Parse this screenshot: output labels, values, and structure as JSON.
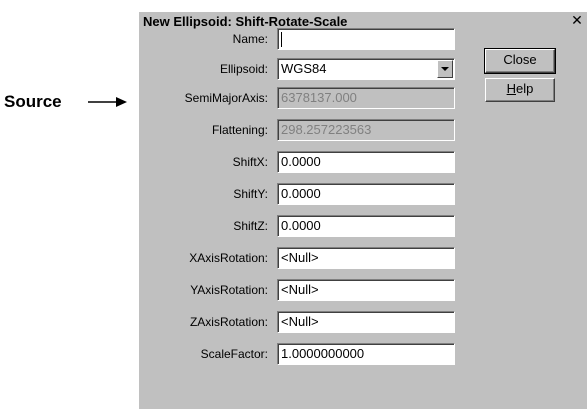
{
  "annotation": {
    "text": "Source"
  },
  "dialog": {
    "title": "New Ellipsoid: Shift-Rotate-Scale",
    "close_glyph": "✕",
    "fields": {
      "name": {
        "label": "Name:",
        "value": ""
      },
      "ellipsoid": {
        "label": "Ellipsoid:",
        "value": "WGS84"
      },
      "semimajor": {
        "label": "SemiMajorAxis:",
        "value": "6378137.000"
      },
      "flattening": {
        "label": "Flattening:",
        "value": "298.257223563"
      },
      "shiftx": {
        "label": "ShiftX:",
        "value": "0.0000"
      },
      "shifty": {
        "label": "ShiftY:",
        "value": "0.0000"
      },
      "shiftz": {
        "label": "ShiftZ:",
        "value": "0.0000"
      },
      "xrot": {
        "label": "XAxisRotation:",
        "value": "<Null>"
      },
      "yrot": {
        "label": "YAxisRotation:",
        "value": "<Null>"
      },
      "zrot": {
        "label": "ZAxisRotation:",
        "value": "<Null>"
      },
      "scale": {
        "label": "ScaleFactor:",
        "value": "1.0000000000"
      }
    },
    "buttons": {
      "close": "Close",
      "help_mnemonic": "H",
      "help_rest": "elp"
    }
  }
}
